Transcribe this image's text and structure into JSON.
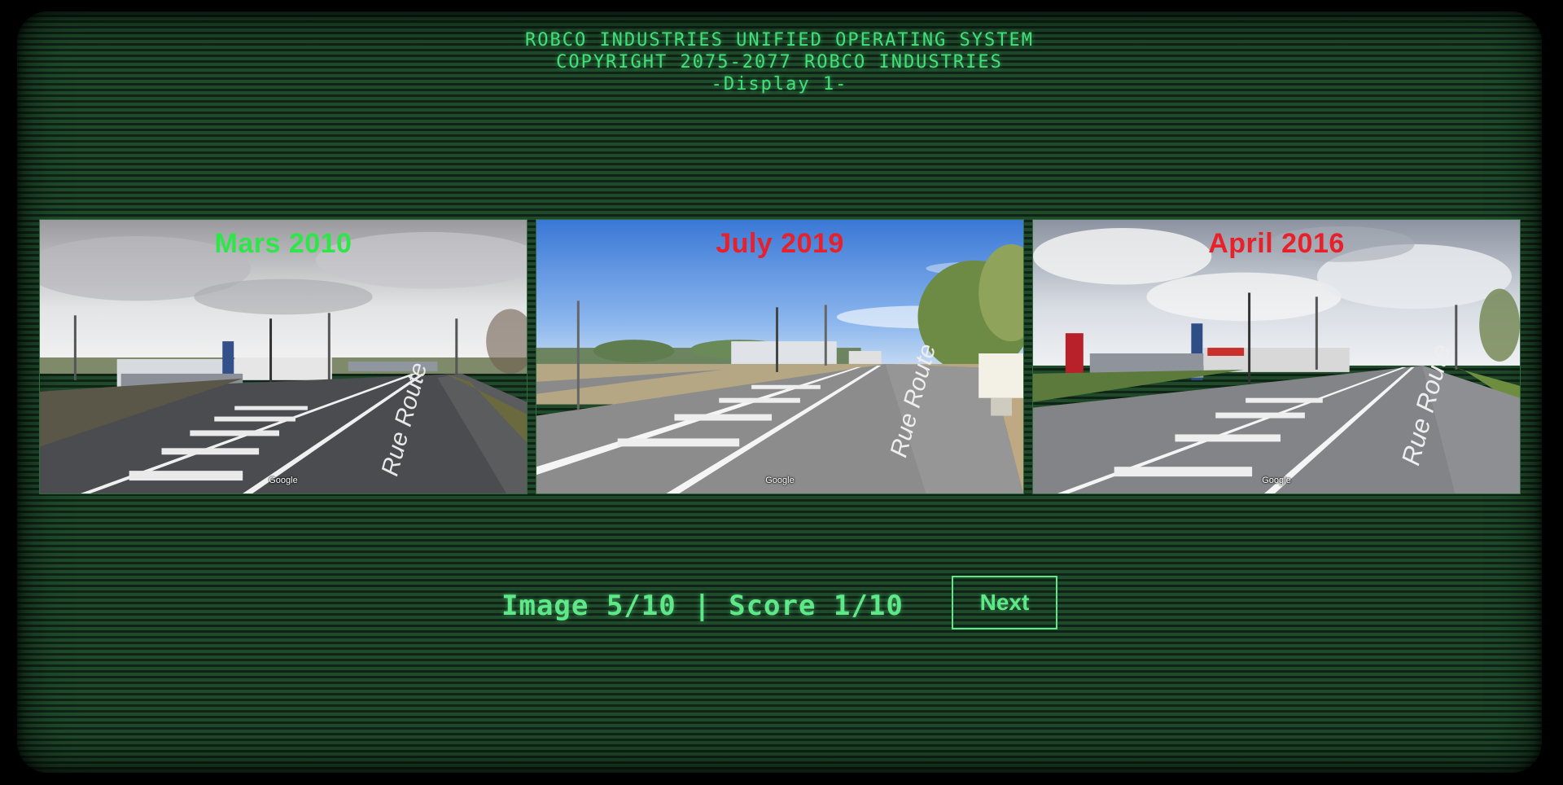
{
  "header": {
    "line1": "ROBCO INDUSTRIES UNIFIED OPERATING SYSTEM",
    "line2": "COPYRIGHT 2075-2077 ROBCO INDUSTRIES",
    "line3": "-Display 1-"
  },
  "panels": [
    {
      "label": "Mars 2010",
      "state": "correct",
      "color": "#2ee64a",
      "image": "street-view-photo",
      "watermark": "Google"
    },
    {
      "label": "July 2019",
      "state": "wrong",
      "color": "#e8202a",
      "image": "street-view-photo",
      "watermark": "Google"
    },
    {
      "label": "April 2016",
      "state": "wrong",
      "color": "#e8202a",
      "image": "street-view-photo",
      "watermark": "Google"
    }
  ],
  "status": {
    "text": "Image 5/10 | Score 1/10",
    "image_index": 5,
    "image_total": 10,
    "score": 1,
    "score_total": 10
  },
  "next_button": {
    "label": "Next"
  },
  "colors": {
    "terminal_green": "#43e07a",
    "bright_green": "#5ee888",
    "correct": "#2ee64a",
    "wrong": "#e8202a",
    "background": "#1f4a2a"
  }
}
